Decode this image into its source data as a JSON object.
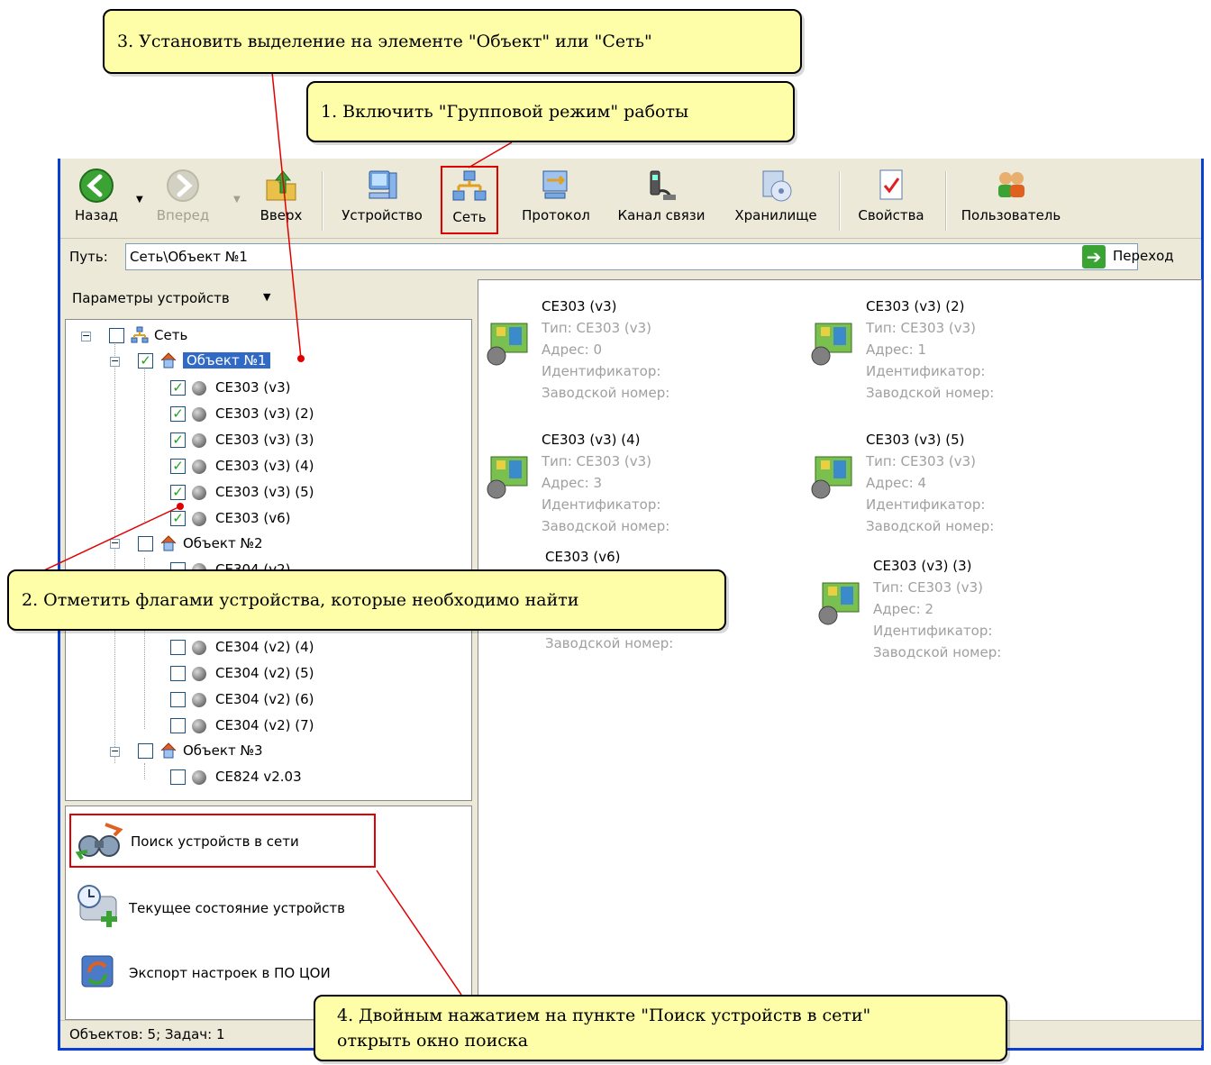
{
  "toolbar": {
    "back": "Назад",
    "forward": "Вперед",
    "up": "Вверх",
    "device": "Устройство",
    "network": "Сеть",
    "protocol": "Протокол",
    "channel": "Канал связи",
    "storage": "Хранилище",
    "properties": "Свойства",
    "users": "Пользователь"
  },
  "address": {
    "label": "Путь:",
    "value": "Сеть\\Объект №1",
    "go": "Переход"
  },
  "left_panel": {
    "header": "Параметры устройств",
    "tree": {
      "root": "Сеть",
      "object1": "Объект №1",
      "object1_devices": [
        "CE303 (v3)",
        "CE303 (v3) (2)",
        "CE303 (v3) (3)",
        "CE303 (v3) (4)",
        "CE303 (v3) (5)",
        "CE303 (v6)"
      ],
      "object2": "Объект №2",
      "object2_devices": [
        "CE304 (v2)",
        "CE304 (v2) (4)",
        "CE304 (v2) (5)",
        "CE304 (v2) (6)",
        "CE304 (v2) (7)"
      ],
      "object3": "Объект №3",
      "object3_devices": [
        "CE824 v2.03"
      ]
    },
    "tasks": [
      "Поиск устройств в сети",
      "Текущее состояние устройств",
      "Экспорт настроек в ПО ЦОИ"
    ]
  },
  "devices": [
    {
      "name": "CE303 (v3)",
      "type": "Тип: CE303 (v3)",
      "addr": "Адрес: 0",
      "id": "Идентификатор:",
      "serial": "Заводской номер:"
    },
    {
      "name": "CE303 (v3) (2)",
      "type": "Тип: CE303 (v3)",
      "addr": "Адрес: 1",
      "id": "Идентификатор:",
      "serial": "Заводской номер:"
    },
    {
      "name": "CE303 (v3) (4)",
      "type": "Тип: CE303 (v3)",
      "addr": "Адрес: 3",
      "id": "Идентификатор:",
      "serial": "Заводской номер:"
    },
    {
      "name": "CE303 (v3) (5)",
      "type": "Тип: CE303 (v3)",
      "addr": "Адрес: 4",
      "id": "Идентификатор:",
      "serial": "Заводской номер:"
    },
    {
      "name": "CE303 (v6)",
      "serial": "Заводской номер:"
    },
    {
      "name": "CE303 (v3) (3)",
      "type": "Тип: CE303 (v3)",
      "addr": "Адрес: 2",
      "id": "Идентификатор:",
      "serial": "Заводской номер:"
    }
  ],
  "status": "Объектов: 5; Задач: 1",
  "callouts": {
    "c1": "1. Включить \"Групповой режим\" работы",
    "c2": "2. Отметить флагами устройства, которые необходимо найти",
    "c3": "3. Установить выделение на элементе \"Объект\" или \"Сеть\"",
    "c4_line1": "4. Двойным нажатием на пункте \"Поиск устройств в сети\"",
    "c4_line2": "открыть окно поиска"
  },
  "colors": {
    "accent": "#316ac5",
    "callout": "#fefea8",
    "highlight": "#e00000",
    "window_border": "#0a3fd3"
  }
}
